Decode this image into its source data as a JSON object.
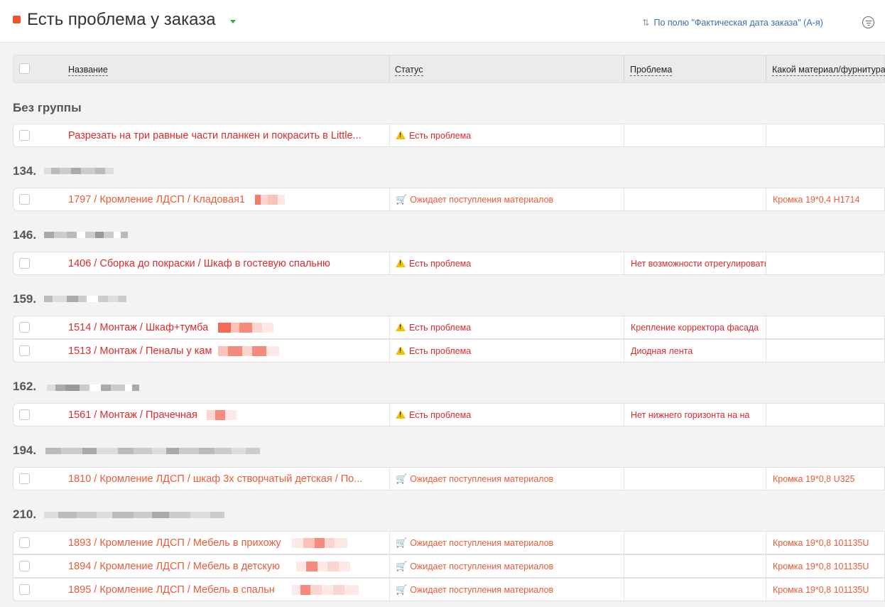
{
  "header": {
    "title": "Есть проблема у заказа",
    "sort_label": "По полю \"Фактическая дата заказа\" (А-я)",
    "accent_color": "#f0532d"
  },
  "columns": {
    "name": "Название",
    "status": "Статус",
    "problem": "Проблема",
    "material": "Какой материал/фурнитура"
  },
  "groups": [
    {
      "title": "Без группы"
    },
    {
      "title": "134."
    },
    {
      "title": "146."
    },
    {
      "title": "159."
    },
    {
      "title": "162."
    },
    {
      "title": "194."
    },
    {
      "title": "210."
    }
  ],
  "rows": [
    {
      "name": "Разрезать на три равные части планкен и покрасить в Little...",
      "status": "Есть проблема",
      "problem": "",
      "material": ""
    },
    {
      "name": "1797 / Кромление ЛДСП / Кладовая1",
      "status": "Ожидает поступления материалов",
      "problem": "",
      "material": "Кромка 19*0,4 H1714"
    },
    {
      "name": "1406 / Сборка до покраски / Шкаф в гостевую спальню",
      "status": "Есть проблема",
      "problem": "Нет возможности отрегулировать",
      "material": ""
    },
    {
      "name": "1514 / Монтаж / Шкаф+тумба",
      "status": "Есть проблема",
      "problem": "Крепление корректора фасада",
      "material": ""
    },
    {
      "name": "1513 / Монтаж / Пеналы у кам",
      "status": "Есть проблема",
      "problem": "Диодная лента",
      "material": ""
    },
    {
      "name": "1561 / Монтаж / Прачечная",
      "status": "Есть проблема",
      "problem": "Нет нижнего горизонта на на",
      "material": ""
    },
    {
      "name": "1810 / Кромление ЛДСП / шкаф 3х створчатый детская / По...",
      "status": "Ожидает поступления материалов",
      "problem": "",
      "material": "Кромка 19*0,8 U325"
    },
    {
      "name": "1893 / Кромление ЛДСП / Мебель в прихожу",
      "status": "Ожидает поступления материалов",
      "problem": "",
      "material": "Кромка 19*0,8 101135U"
    },
    {
      "name": "1894 / Кромление ЛДСП / Мебель в детскую",
      "status": "Ожидает поступления материалов",
      "problem": "",
      "material": "Кромка 19*0,8 101135U"
    },
    {
      "name": "1895 / Кромление ЛДСП / Мебель в спальн",
      "status": "Ожидает поступления материалов",
      "problem": "",
      "material": "Кромка 19*0,8 101135U"
    }
  ],
  "icons": {
    "problem": "warning-icon",
    "waiting": "cart-icon",
    "filter": "filter-icon",
    "sort": "sort-arrows-icon"
  }
}
